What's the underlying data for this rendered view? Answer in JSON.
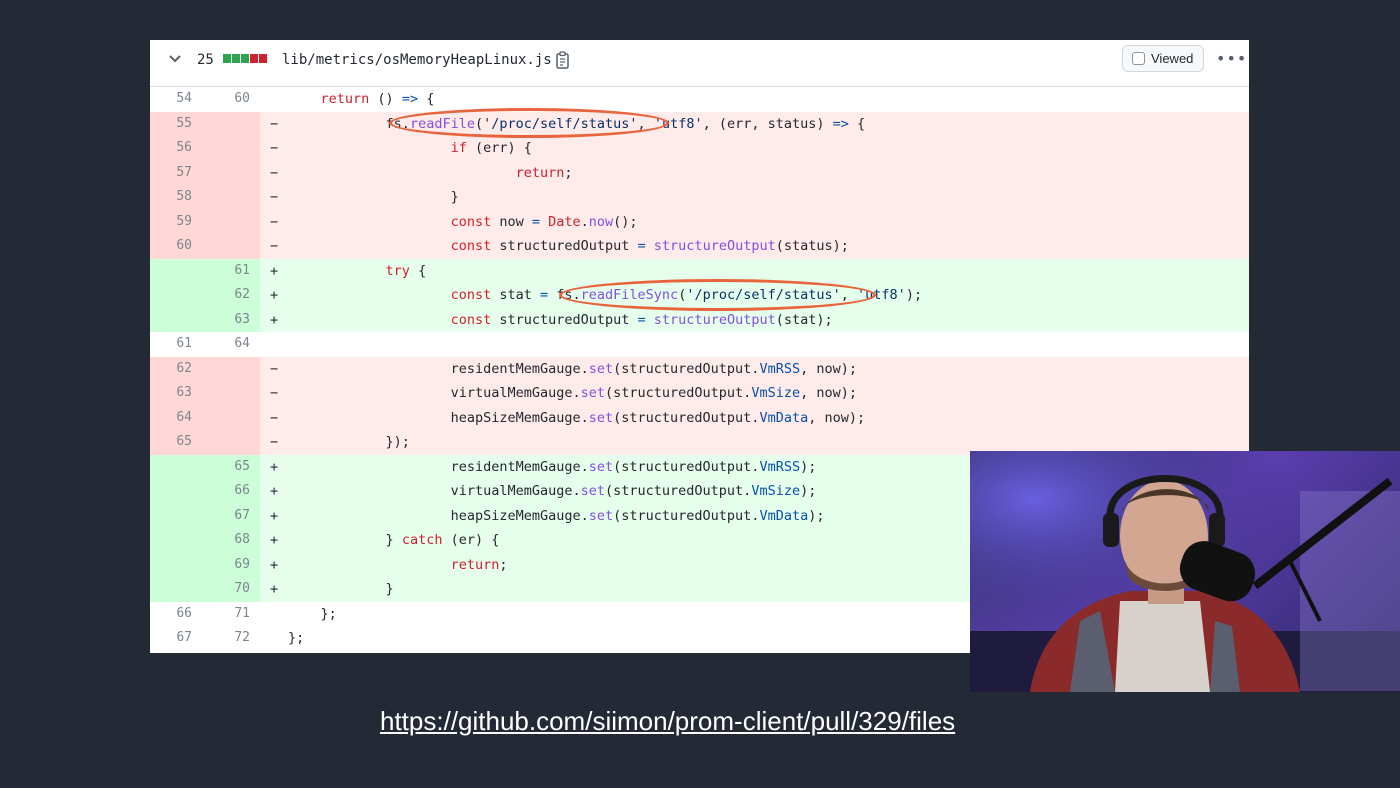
{
  "file_header": {
    "changes": "25",
    "diffstat_colors": [
      "#2da44e",
      "#2da44e",
      "#2da44e",
      "#cf222e",
      "#cf222e"
    ],
    "filename": "lib/metrics/osMemoryHeapLinux.js",
    "viewed_label": "Viewed",
    "more_label": "•••"
  },
  "diff_lines": [
    {
      "type": "ctx",
      "old": "54",
      "new": "60",
      "marker": "",
      "indent": "    ",
      "tokens": [
        [
          "kw",
          "return"
        ],
        [
          "",
          " () "
        ],
        [
          "op",
          "=>"
        ],
        [
          "",
          " {"
        ]
      ]
    },
    {
      "type": "del",
      "old": "55",
      "new": "",
      "marker": "−",
      "indent": "            ",
      "tokens": [
        [
          "",
          "fs."
        ],
        [
          "fn",
          "readFile"
        ],
        [
          "",
          "("
        ],
        [
          "st",
          "'/proc/self/status'"
        ],
        [
          "",
          ", "
        ],
        [
          "st",
          "'utf8'"
        ],
        [
          "",
          ", (err, status) "
        ],
        [
          "op",
          "=>"
        ],
        [
          "",
          " {"
        ]
      ]
    },
    {
      "type": "del",
      "old": "56",
      "new": "",
      "marker": "−",
      "indent": "                    ",
      "tokens": [
        [
          "kw",
          "if"
        ],
        [
          "",
          " (err) {"
        ]
      ]
    },
    {
      "type": "del",
      "old": "57",
      "new": "",
      "marker": "−",
      "indent": "                            ",
      "tokens": [
        [
          "kw",
          "return"
        ],
        [
          "",
          ";"
        ]
      ]
    },
    {
      "type": "del",
      "old": "58",
      "new": "",
      "marker": "−",
      "indent": "                    ",
      "tokens": [
        [
          "",
          "}"
        ]
      ]
    },
    {
      "type": "del",
      "old": "59",
      "new": "",
      "marker": "−",
      "indent": "                    ",
      "tokens": [
        [
          "kw",
          "const"
        ],
        [
          "",
          " now "
        ],
        [
          "op",
          "="
        ],
        [
          "",
          " "
        ],
        [
          "kw",
          "Date"
        ],
        [
          "",
          "."
        ],
        [
          "fn",
          "now"
        ],
        [
          "",
          "();"
        ]
      ]
    },
    {
      "type": "del",
      "old": "60",
      "new": "",
      "marker": "−",
      "indent": "                    ",
      "tokens": [
        [
          "kw",
          "const"
        ],
        [
          "",
          " structuredOutput "
        ],
        [
          "op",
          "="
        ],
        [
          "",
          " "
        ],
        [
          "fn",
          "structureOutput"
        ],
        [
          "",
          "(status);"
        ]
      ]
    },
    {
      "type": "add",
      "old": "",
      "new": "61",
      "marker": "+",
      "indent": "            ",
      "tokens": [
        [
          "kw",
          "try"
        ],
        [
          "",
          " {"
        ]
      ]
    },
    {
      "type": "add",
      "old": "",
      "new": "62",
      "marker": "+",
      "indent": "                    ",
      "tokens": [
        [
          "kw",
          "const"
        ],
        [
          "",
          " stat "
        ],
        [
          "op",
          "="
        ],
        [
          "",
          " fs."
        ],
        [
          "fn",
          "readFileSync"
        ],
        [
          "",
          "("
        ],
        [
          "st",
          "'/proc/self/status'"
        ],
        [
          "",
          ", "
        ],
        [
          "st",
          "'utf8'"
        ],
        [
          "",
          ");"
        ]
      ]
    },
    {
      "type": "add",
      "old": "",
      "new": "63",
      "marker": "+",
      "indent": "                    ",
      "tokens": [
        [
          "kw",
          "const"
        ],
        [
          "",
          " structuredOutput "
        ],
        [
          "op",
          "="
        ],
        [
          "",
          " "
        ],
        [
          "fn",
          "structureOutput"
        ],
        [
          "",
          "(stat);"
        ]
      ]
    },
    {
      "type": "ctx",
      "old": "61",
      "new": "64",
      "marker": "",
      "indent": "",
      "tokens": []
    },
    {
      "type": "del",
      "old": "62",
      "new": "",
      "marker": "−",
      "indent": "                    ",
      "tokens": [
        [
          "",
          "residentMemGauge."
        ],
        [
          "fn",
          "set"
        ],
        [
          "",
          "(structuredOutput."
        ],
        [
          "pr",
          "VmRSS"
        ],
        [
          "",
          ", now);"
        ]
      ]
    },
    {
      "type": "del",
      "old": "63",
      "new": "",
      "marker": "−",
      "indent": "                    ",
      "tokens": [
        [
          "",
          "virtualMemGauge."
        ],
        [
          "fn",
          "set"
        ],
        [
          "",
          "(structuredOutput."
        ],
        [
          "pr",
          "VmSize"
        ],
        [
          "",
          ", now);"
        ]
      ]
    },
    {
      "type": "del",
      "old": "64",
      "new": "",
      "marker": "−",
      "indent": "                    ",
      "tokens": [
        [
          "",
          "heapSizeMemGauge."
        ],
        [
          "fn",
          "set"
        ],
        [
          "",
          "(structuredOutput."
        ],
        [
          "pr",
          "VmData"
        ],
        [
          "",
          ", now);"
        ]
      ]
    },
    {
      "type": "del",
      "old": "65",
      "new": "",
      "marker": "−",
      "indent": "            ",
      "tokens": [
        [
          "",
          "});"
        ]
      ]
    },
    {
      "type": "add",
      "old": "",
      "new": "65",
      "marker": "+",
      "indent": "                    ",
      "tokens": [
        [
          "",
          "residentMemGauge."
        ],
        [
          "fn",
          "set"
        ],
        [
          "",
          "(structuredOutput."
        ],
        [
          "pr",
          "VmRSS"
        ],
        [
          "",
          ");"
        ]
      ]
    },
    {
      "type": "add",
      "old": "",
      "new": "66",
      "marker": "+",
      "indent": "                    ",
      "tokens": [
        [
          "",
          "virtualMemGauge."
        ],
        [
          "fn",
          "set"
        ],
        [
          "",
          "(structuredOutput."
        ],
        [
          "pr",
          "VmSize"
        ],
        [
          "",
          ");"
        ]
      ]
    },
    {
      "type": "add",
      "old": "",
      "new": "67",
      "marker": "+",
      "indent": "                    ",
      "tokens": [
        [
          "",
          "heapSizeMemGauge."
        ],
        [
          "fn",
          "set"
        ],
        [
          "",
          "(structuredOutput."
        ],
        [
          "pr",
          "VmData"
        ],
        [
          "",
          ");"
        ]
      ]
    },
    {
      "type": "add",
      "old": "",
      "new": "68",
      "marker": "+",
      "indent": "            ",
      "tokens": [
        [
          "",
          "} "
        ],
        [
          "kw",
          "catch"
        ],
        [
          "",
          " (er) {"
        ]
      ]
    },
    {
      "type": "add",
      "old": "",
      "new": "69",
      "marker": "+",
      "indent": "                    ",
      "tokens": [
        [
          "kw",
          "return"
        ],
        [
          "",
          ";"
        ]
      ]
    },
    {
      "type": "add",
      "old": "",
      "new": "70",
      "marker": "+",
      "indent": "            ",
      "tokens": [
        [
          "",
          "}"
        ]
      ]
    },
    {
      "type": "ctx",
      "old": "66",
      "new": "71",
      "marker": "",
      "indent": "    ",
      "tokens": [
        [
          "",
          "};"
        ]
      ]
    },
    {
      "type": "ctx",
      "old": "67",
      "new": "72",
      "marker": "",
      "indent": "",
      "tokens": [
        [
          "",
          "};"
        ]
      ]
    }
  ],
  "annotation_color": "#e8643c",
  "link_url": "https://github.com/siimon/prom-client/pull/329/files"
}
